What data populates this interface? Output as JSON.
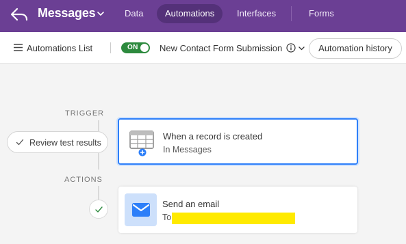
{
  "header": {
    "title": "Messages",
    "tabs": [
      {
        "label": "Data",
        "active": false
      },
      {
        "label": "Automations",
        "active": true
      },
      {
        "label": "Interfaces",
        "active": false
      },
      {
        "label": "Forms",
        "active": false
      }
    ],
    "brand_color": "#6b3f94"
  },
  "toolbar": {
    "list_label": "Automations List",
    "toggle_label": "ON",
    "toggle_state": "on",
    "automation_name": "New Contact Form Submission",
    "history_label": "Automation history"
  },
  "flow": {
    "trigger_section": "TRIGGER",
    "actions_section": "ACTIONS",
    "review_label": "Review test results",
    "trigger": {
      "title": "When a record is created",
      "subtitle": "In Messages",
      "icon": "table-plus-icon"
    },
    "action": {
      "title": "Send an email",
      "subtitle": "To",
      "icon": "mail-icon",
      "redacted": true
    }
  }
}
